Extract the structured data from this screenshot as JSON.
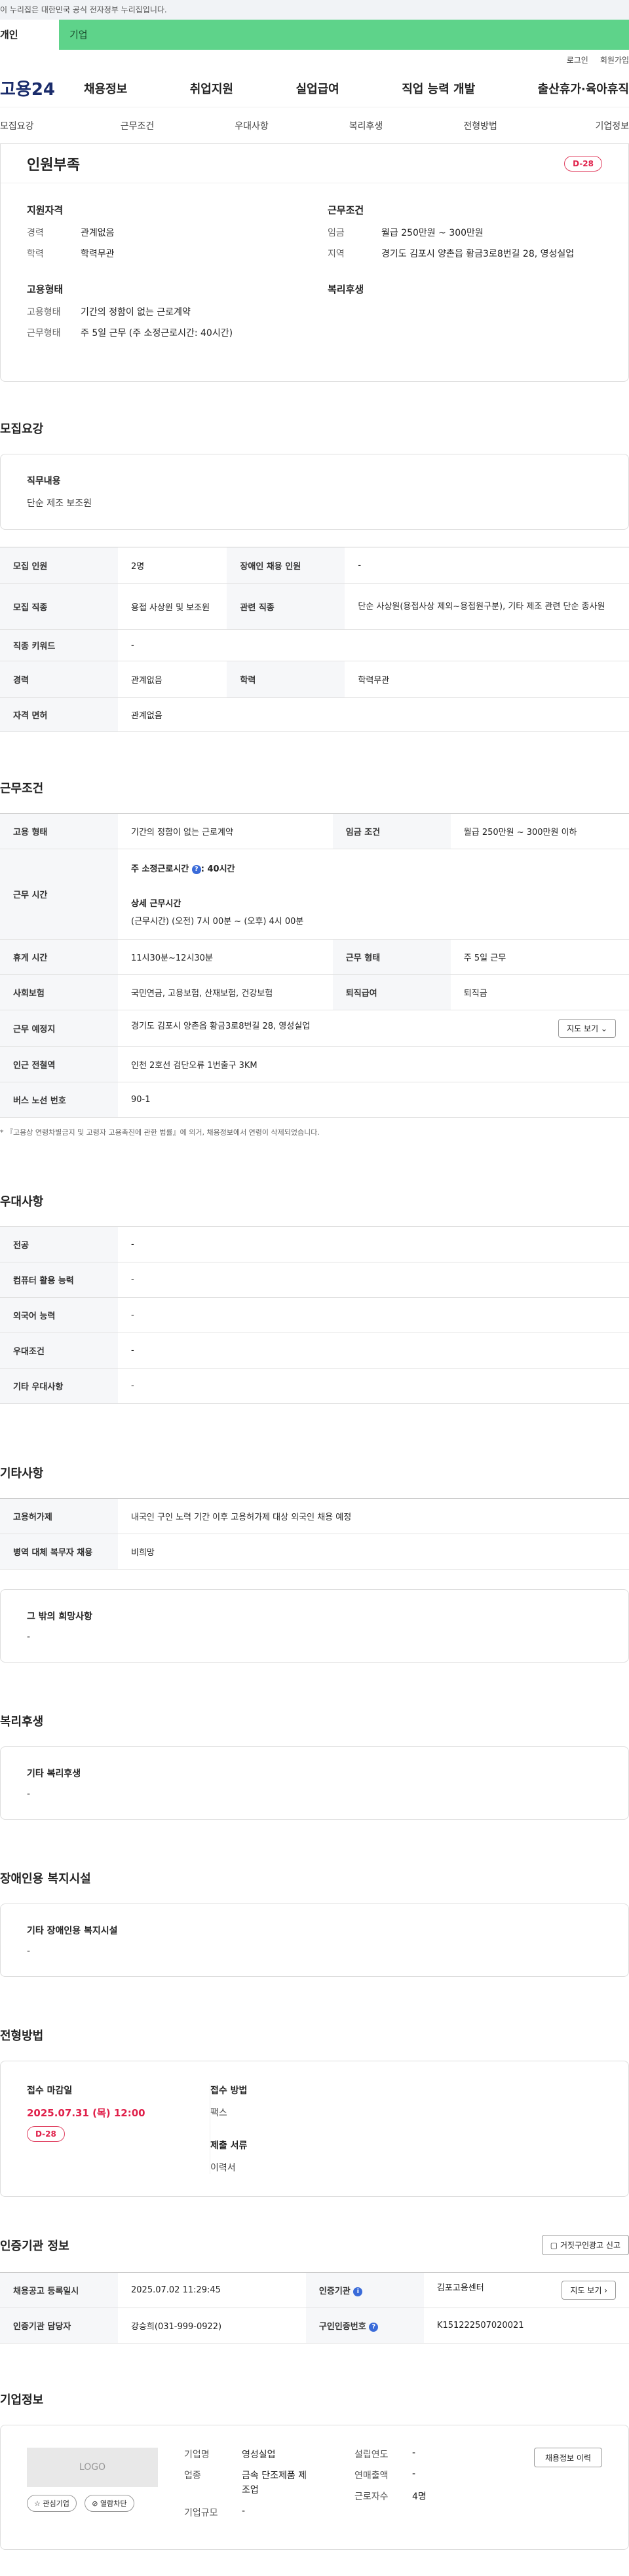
{
  "gov_bar": "이 누리집은 대한민국 공식 전자정부 누리집입니다.",
  "user_tabs": [
    "개인",
    "기업"
  ],
  "util": [
    "로그인",
    "회원가입"
  ],
  "logo": "고용24",
  "gnb": [
    "채용정보",
    "취업지원",
    "실업급여",
    "직업 능력 개발",
    "출산휴가·육아휴직"
  ],
  "subnav": [
    "모집요강",
    "근무조건",
    "우대사항",
    "복리후생",
    "전형방법",
    "기업정보"
  ],
  "summary": {
    "title": "인원부족",
    "dday": "D-28",
    "qual_h": "지원자격",
    "qual": [
      {
        "k": "경력",
        "v": "관계없음"
      },
      {
        "k": "학력",
        "v": "학력무관"
      }
    ],
    "cond_h": "근무조건",
    "cond": [
      {
        "k": "임금",
        "v": "월급 250만원 ~ 300만원"
      },
      {
        "k": "지역",
        "v": "경기도 김포시 양촌읍 황금3로8번길 28, 영성실업"
      }
    ],
    "emp_h": "고용형태",
    "emp": [
      {
        "k": "고용형태",
        "v": "기간의 정함이 없는 근로계약"
      },
      {
        "k": "근무형태",
        "v": "주 5일 근무 (주 소정근로시간: 40시간)"
      }
    ],
    "welfare_h": "복리후생"
  },
  "recruit": {
    "title": "모집요강",
    "duty_h": "직무내용",
    "duty": "단순 제조 보조원",
    "rows": [
      {
        "k1": "모집 인원",
        "v1": "2명",
        "k2": "장애인 채용 인원",
        "v2": "-"
      },
      {
        "k1": "모집 직종",
        "v1": "용접 사상원 및 보조원",
        "k2": "관련 직종",
        "v2": "단순 사상원(용접사상 제외~용접원구분), 기타 제조 관련 단순 종사원"
      },
      {
        "k1": "직종 키워드",
        "v1": "-"
      },
      {
        "k1": "경력",
        "v1": "관계없음",
        "k2": "학력",
        "v2": "학력무관"
      },
      {
        "k1": "자격 면허",
        "v1": "관계없음"
      }
    ]
  },
  "work": {
    "title": "근무조건",
    "r1": {
      "k1": "고용 형태",
      "v1": "기간의 정함이 없는 근로계약",
      "k2": "임금 조건",
      "v2": "월급 250만원 ~ 300만원 이하"
    },
    "hours_k": "근무 시간",
    "hours_a": "주 소정근로시간",
    "hours_b": ": 40시간",
    "hours_c": "상세 근무시간",
    "hours_d": "(근무시간) (오전) 7시 00분 ~ (오후) 4시 00분",
    "r3": {
      "k1": "휴게 시간",
      "v1": "11시30분~12시30분",
      "k2": "근무 형태",
      "v2": "주 5일 근무"
    },
    "r4": {
      "k1": "사회보험",
      "v1": "국민연금, 고용보험, 산재보험, 건강보험",
      "k2": "퇴직급여",
      "v2": "퇴직금"
    },
    "r5": {
      "k1": "근무 예정지",
      "v1": "경기도 김포시 양촌읍 황금3로8번길 28, 영성실업",
      "btn": "지도 보기 ⌄"
    },
    "r6": {
      "k1": "인근 전철역",
      "v1": "인천 2호선 검단오류 1번출구 3KM"
    },
    "r7": {
      "k1": "버스 노선 번호",
      "v1": "90-1"
    },
    "note": "* 『고용상 연령차별금지 및 고령자 고용촉진에 관한 법률』에 의거, 채용정보에서 연령이 삭제되었습니다."
  },
  "pref": {
    "title": "우대사항",
    "rows": [
      {
        "k": "전공",
        "v": "-"
      },
      {
        "k": "컴퓨터 활용 능력",
        "v": "-"
      },
      {
        "k": "외국어 능력",
        "v": "-"
      },
      {
        "k": "우대조건",
        "v": "-"
      },
      {
        "k": "기타 우대사항",
        "v": "-"
      }
    ]
  },
  "etc": {
    "title": "기타사항",
    "rows": [
      {
        "k": "고용허가제",
        "v": "내국인 구인 노력 기간 이후 고용허가제 대상 외국인 채용 예정"
      },
      {
        "k": "병역 대체 복무자 채용",
        "v": "비희망"
      }
    ],
    "card_h": "그 밖의 희망사항",
    "card_v": "-"
  },
  "welfare": {
    "title": "복리후생",
    "h": "기타 복리후생",
    "v": "-"
  },
  "disabled": {
    "title": "장애인용 복지시설",
    "h": "기타 장애인용 복지시설",
    "v": "-"
  },
  "selection": {
    "title": "전형방법",
    "deadline_h": "접수 마감일",
    "deadline": "2025.07.31 (목) 12:00",
    "dday": "D-28",
    "method_h": "접수 방법",
    "method": "팩스",
    "docs_h": "제출 서류",
    "docs": "이력서"
  },
  "agency": {
    "title": "인증기관 정보",
    "report": "거짓구인광고 신고",
    "r1": {
      "k1": "채용공고 등록일시",
      "v1": "2025.07.02 11:29:45",
      "k2": "인증기관",
      "v2": "김포고용센터",
      "btn": "지도 보기 ›"
    },
    "r2": {
      "k1": "인증기관 담당자",
      "v1": "강승희(031-999-0922)",
      "k2": "구인인증번호",
      "v2": "K151222507020021"
    }
  },
  "company": {
    "title": "기업정보",
    "logo": "LOGO",
    "btn1": "☆ 관심기업",
    "btn2": "⊘ 열람차단",
    "col1": [
      {
        "k": "기업명",
        "v": "영성실업"
      },
      {
        "k": "업종",
        "v": "금속 단조제품 제조업"
      },
      {
        "k": "기업규모",
        "v": "-"
      }
    ],
    "col2": [
      {
        "k": "설립연도",
        "v": "-"
      },
      {
        "k": "연매출액",
        "v": "-"
      },
      {
        "k": "근로자수",
        "v": "4명"
      }
    ],
    "history": "채용정보 이력"
  }
}
